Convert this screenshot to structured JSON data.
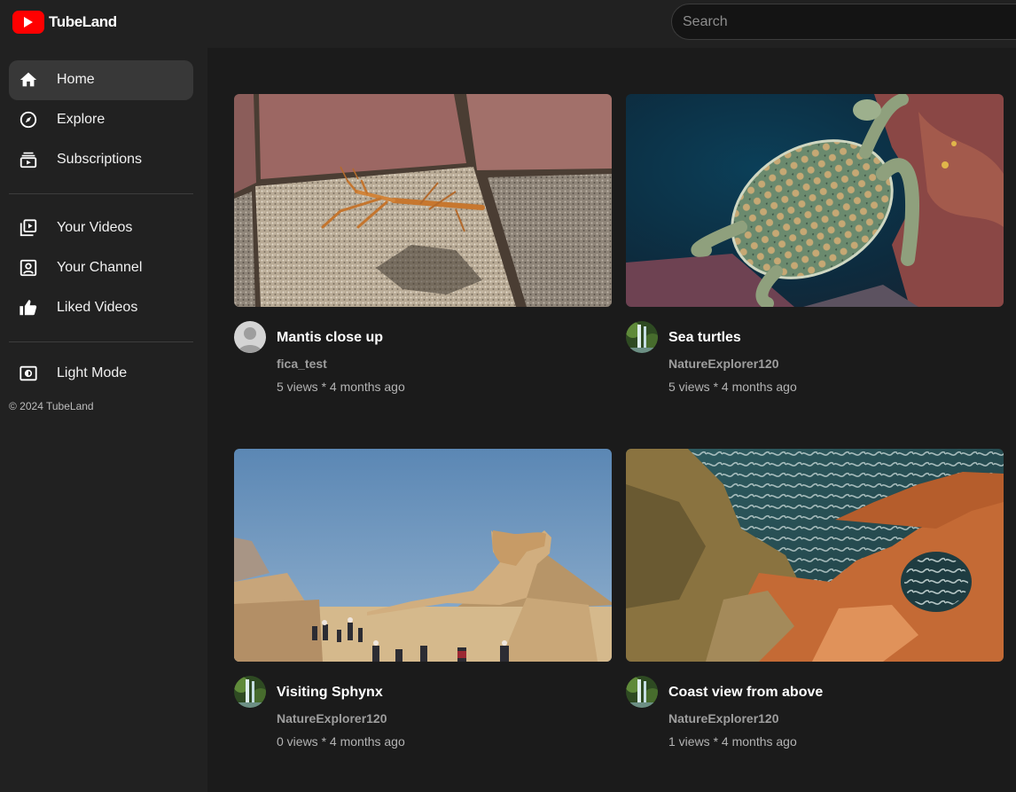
{
  "app": {
    "name": "TubeLand"
  },
  "search": {
    "placeholder": "Search"
  },
  "sidebar": {
    "items": [
      {
        "label": "Home",
        "icon": "home-icon",
        "active": true
      },
      {
        "label": "Explore",
        "icon": "compass-icon",
        "active": false
      },
      {
        "label": "Subscriptions",
        "icon": "subscriptions-icon",
        "active": false
      },
      {
        "label": "Your Videos",
        "icon": "video-library-icon",
        "active": false
      },
      {
        "label": "Your Channel",
        "icon": "channel-icon",
        "active": false
      },
      {
        "label": "Liked Videos",
        "icon": "thumbs-up-icon",
        "active": false
      },
      {
        "label": "Light Mode",
        "icon": "theme-toggle-icon",
        "active": false
      }
    ],
    "copyright": "© 2024 TubeLand"
  },
  "videos": [
    {
      "title": "Mantis close up",
      "channel": "fica_test",
      "views": "5 views",
      "separator": "*",
      "age": "4 months ago",
      "thumbnail": "mantis-on-paving-stones",
      "avatar": "default-user-avatar"
    },
    {
      "title": "Sea turtles",
      "channel": "NatureExplorer120",
      "views": "5 views",
      "separator": "*",
      "age": "4 months ago",
      "thumbnail": "sea-turtle-over-reef",
      "avatar": "waterfall-avatar"
    },
    {
      "title": "Visiting Sphynx",
      "channel": "NatureExplorer120",
      "views": "0 views",
      "separator": "*",
      "age": "4 months ago",
      "thumbnail": "sphinx-and-pyramid",
      "avatar": "waterfall-avatar"
    },
    {
      "title": "Coast view from above",
      "channel": "NatureExplorer120",
      "views": "1 views",
      "separator": "*",
      "age": "4 months ago",
      "thumbnail": "rocky-coast-aerial",
      "avatar": "waterfall-avatar"
    }
  ],
  "colors": {
    "brand": "#ff0000",
    "background": "#1b1b1b",
    "panel": "#212121",
    "active": "#383838"
  }
}
